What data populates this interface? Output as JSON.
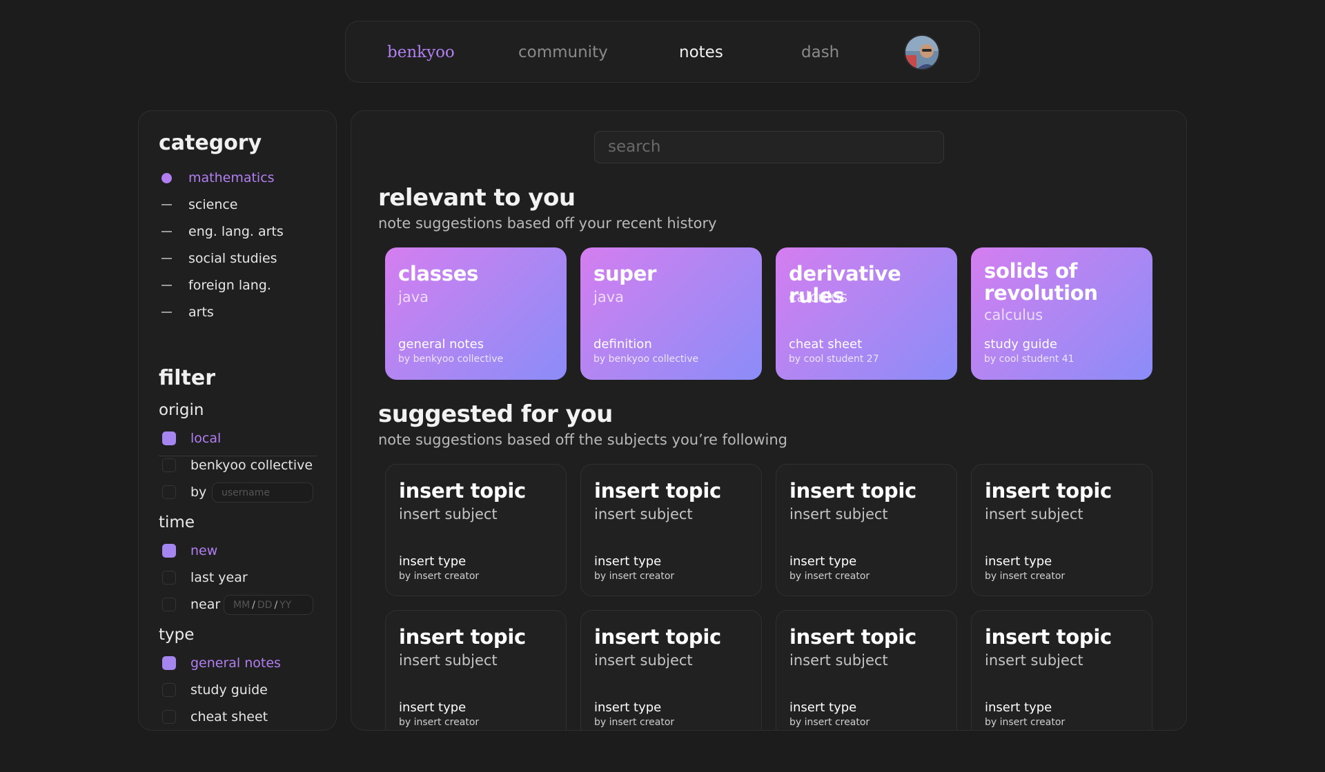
{
  "nav": {
    "brand": "benkyoo",
    "community": "community",
    "notes": "notes",
    "dash": "dash"
  },
  "sidebar": {
    "category_heading": "category",
    "categories": [
      {
        "label": "mathematics",
        "active": true
      },
      {
        "label": "science",
        "active": false
      },
      {
        "label": "eng. lang. arts",
        "active": false
      },
      {
        "label": "social studies",
        "active": false
      },
      {
        "label": "foreign lang.",
        "active": false
      },
      {
        "label": "arts",
        "active": false
      }
    ],
    "filter_heading": "filter",
    "origin": {
      "heading": "origin",
      "options": [
        {
          "label": "local",
          "checked": true
        },
        {
          "label": "benkyoo collective",
          "checked": false
        },
        {
          "label": "by",
          "checked": false
        }
      ],
      "username_placeholder": "username"
    },
    "time": {
      "heading": "time",
      "options": [
        {
          "label": "new",
          "checked": true
        },
        {
          "label": "last year",
          "checked": false
        },
        {
          "label": "near",
          "checked": false
        }
      ],
      "date_mm": "MM",
      "date_dd": "DD",
      "date_yy": "YY",
      "date_sep": "/"
    },
    "type": {
      "heading": "type",
      "options": [
        {
          "label": "general notes",
          "checked": true
        },
        {
          "label": "study guide",
          "checked": false
        },
        {
          "label": "cheat sheet",
          "checked": false
        }
      ]
    }
  },
  "main": {
    "search_placeholder": "search",
    "relevant": {
      "title": "relevant to you",
      "subtitle": "note suggestions based off your recent history",
      "cards": [
        {
          "topic": "classes",
          "subject": "java",
          "type": "general notes",
          "creator": "by benkyoo collective"
        },
        {
          "topic": "super",
          "subject": "java",
          "type": "definition",
          "creator": "by benkyoo collective"
        },
        {
          "topic": "derivative rules",
          "subject": "calculus",
          "type": "cheat sheet",
          "creator": "by cool student 27"
        },
        {
          "topic": "solids of revolution",
          "subject": "calculus",
          "type": "study guide",
          "creator": "by cool student 41"
        }
      ]
    },
    "suggested": {
      "title": "suggested for you",
      "subtitle": "note suggestions based off the subjects you’re following",
      "cards": [
        {
          "topic": "insert topic",
          "subject": "insert subject",
          "type": "insert type",
          "creator": "by insert creator"
        },
        {
          "topic": "insert topic",
          "subject": "insert subject",
          "type": "insert type",
          "creator": "by insert creator"
        },
        {
          "topic": "insert topic",
          "subject": "insert subject",
          "type": "insert type",
          "creator": "by insert creator"
        },
        {
          "topic": "insert topic",
          "subject": "insert subject",
          "type": "insert type",
          "creator": "by insert creator"
        },
        {
          "topic": "insert topic",
          "subject": "insert subject",
          "type": "insert type",
          "creator": "by insert creator"
        },
        {
          "topic": "insert topic",
          "subject": "insert subject",
          "type": "insert type",
          "creator": "by insert creator"
        },
        {
          "topic": "insert topic",
          "subject": "insert subject",
          "type": "insert type",
          "creator": "by insert creator"
        },
        {
          "topic": "insert topic",
          "subject": "insert subject",
          "type": "insert type",
          "creator": "by insert creator"
        }
      ]
    }
  },
  "colors": {
    "accent": "#b27ff3",
    "checkbox_on": "#a585f0",
    "background": "#1c1c1c",
    "panel": "#1f1f1f",
    "card_gradient_start": "#d57df0",
    "card_gradient_end": "#8b8cf8"
  }
}
